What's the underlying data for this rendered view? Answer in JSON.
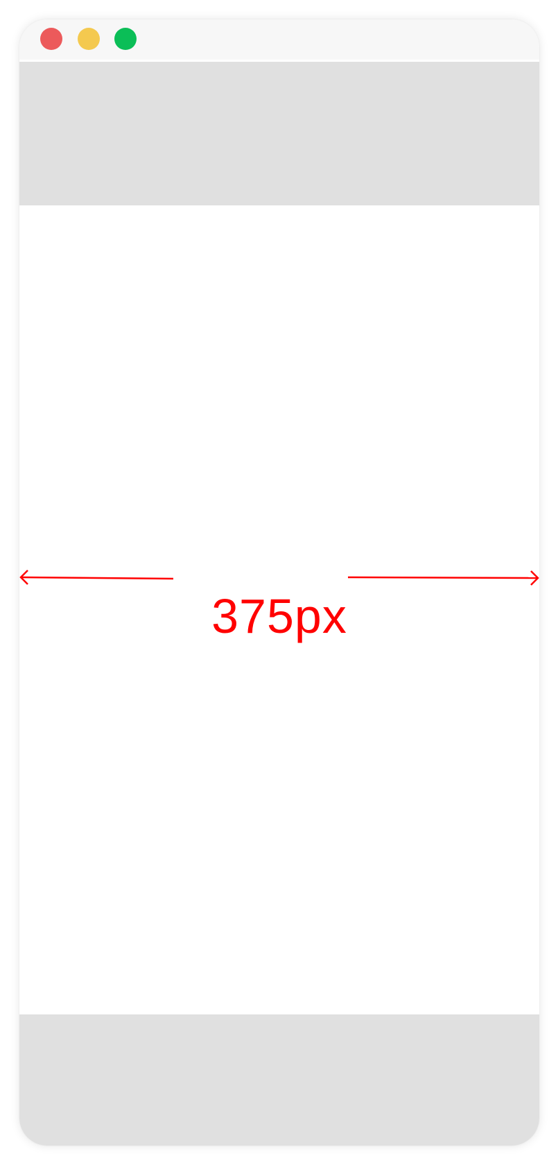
{
  "window": {
    "traffic_lights": {
      "close_color": "#ec5a5b",
      "minimize_color": "#f4c94f",
      "maximize_color": "#0bbe57"
    },
    "placeholder_color": "#e0e0e0"
  },
  "annotation": {
    "width_label": "375px",
    "color": "#ff0000"
  }
}
